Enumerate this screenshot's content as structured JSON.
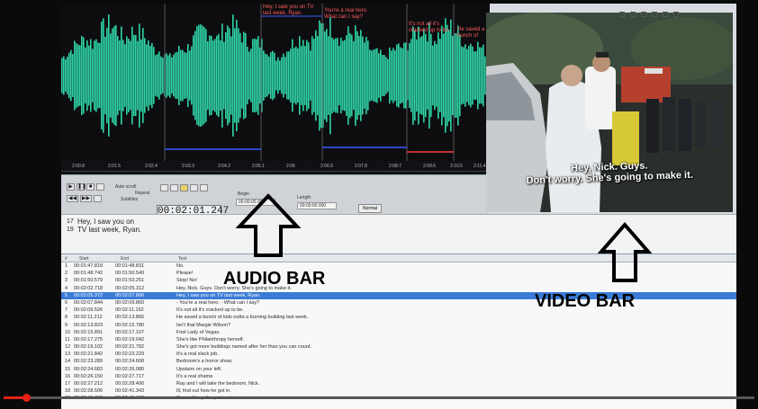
{
  "waveform": {
    "subtitle_labels": [
      {
        "text": "Hey, I saw you on TV last week, Ryan."
      },
      {
        "text": "You're a real hero. What can I say?"
      },
      {
        "text": "It's not all it's cracked up to be."
      },
      {
        "text": "He saved a bunch of"
      }
    ],
    "timeline_ticks": [
      "2:00.8",
      "2:01.5",
      "2:02.4",
      "2:03.3",
      "2:04.2",
      "2:05.1",
      "2:06",
      "2:06.9",
      "2:07.8",
      "2:08.7",
      "2:09.6",
      "2:10.5",
      "2:11.4"
    ],
    "wave_color": "#2fd3a6",
    "marker_color": "#3366ff",
    "end_marker_color": "#ff3b3b"
  },
  "video": {
    "caption_line1": "Hey, Nick. Guys.",
    "caption_line2": "Don't worry. She's going to make it."
  },
  "controls": {
    "time": "00:02:01.247",
    "auto_scroll_label": "Auto scroll",
    "repeat_label": "Repeat",
    "subtitles_label": "Subtitles",
    "begin_label": "Begin",
    "length_label": "Length",
    "begin_value": "00:00:00.000",
    "end_value": "00:00:00.000",
    "normal_label": "Normal",
    "play_label": "▶",
    "pause_label": "❚❚",
    "stop_label": "■",
    "prev_label": "◀◀",
    "next_label": "▶▶"
  },
  "text_edit": {
    "line_numbers": [
      "17",
      "19"
    ],
    "lines": [
      "Hey, I saw you on",
      "TV last week, Ryan."
    ]
  },
  "table": {
    "headers": {
      "num": "#",
      "start": "Start",
      "end": "End",
      "text": "Text"
    },
    "rows": [
      {
        "num": "1",
        "start": "00:01:47.818",
        "end": "00:01:48.831",
        "text": "No."
      },
      {
        "num": "2",
        "start": "00:01:48.742",
        "end": "00:01:50.549",
        "text": "Please!"
      },
      {
        "num": "3",
        "start": "00:01:50.579",
        "end": "00:01:53.251",
        "text": "Stop! No!"
      },
      {
        "num": "4",
        "start": "00:02:02.718",
        "end": "00:02:05.312",
        "text": "Hey, Nick. Guys. Don't worry. She's going to make it."
      },
      {
        "num": "5",
        "start": "00:02:05.372",
        "end": "00:02:07.866",
        "text": "Hey, I saw you on TV last week, Ryan.",
        "selected": true
      },
      {
        "num": "6",
        "start": "00:02:07.844",
        "end": "00:02:09.860",
        "text": "- You're a real hero. - What can I say?"
      },
      {
        "num": "7",
        "start": "00:02:09.526",
        "end": "00:02:11.152",
        "text": "It's not all it's cracked up to be."
      },
      {
        "num": "8",
        "start": "00:02:11.212",
        "end": "00:02:13.865",
        "text": "He saved a bunch of kids outta a burning building last week."
      },
      {
        "num": "9",
        "start": "00:02:13.823",
        "end": "00:02:15.780",
        "text": "Isn't that Margie Wilson?"
      },
      {
        "num": "10",
        "start": "00:02:15.891",
        "end": "00:02:17.107",
        "text": "First Lady of Vegas."
      },
      {
        "num": "11",
        "start": "00:02:17.275",
        "end": "00:02:19.042",
        "text": "She's like Philanthropy herself."
      },
      {
        "num": "12",
        "start": "00:02:19.102",
        "end": "00:02:21.782",
        "text": "She's got more buildings named after her than you can count."
      },
      {
        "num": "13",
        "start": "00:02:21.842",
        "end": "00:02:23.229",
        "text": "It's a real slack job."
      },
      {
        "num": "14",
        "start": "00:02:23.289",
        "end": "00:02:24.608",
        "text": "Bedroom's a horror show."
      },
      {
        "num": "15",
        "start": "00:02:24.683",
        "end": "00:02:26.080",
        "text": "Upstairs on your left."
      },
      {
        "num": "16",
        "start": "00:02:26.150",
        "end": "00:02:27.717",
        "text": "It's a real shame."
      },
      {
        "num": "17",
        "start": "00:02:27.212",
        "end": "00:02:28.490",
        "text": "Ray and I will take the bedroom, Nick."
      },
      {
        "num": "18",
        "start": "00:02:28.506",
        "end": "00:02:41.343",
        "text": "Ill, find out how he got in."
      },
      {
        "num": "19",
        "start": "00:02:41.403",
        "end": "00:02:43.192",
        "text": "Gonna fix up the perimeter."
      }
    ]
  },
  "annotations": {
    "audio_label": "AUDIO BAR",
    "video_label": "VIDEO BAR"
  },
  "player": {
    "progress_fraction": 0.03,
    "progress_color": "#e62117"
  }
}
